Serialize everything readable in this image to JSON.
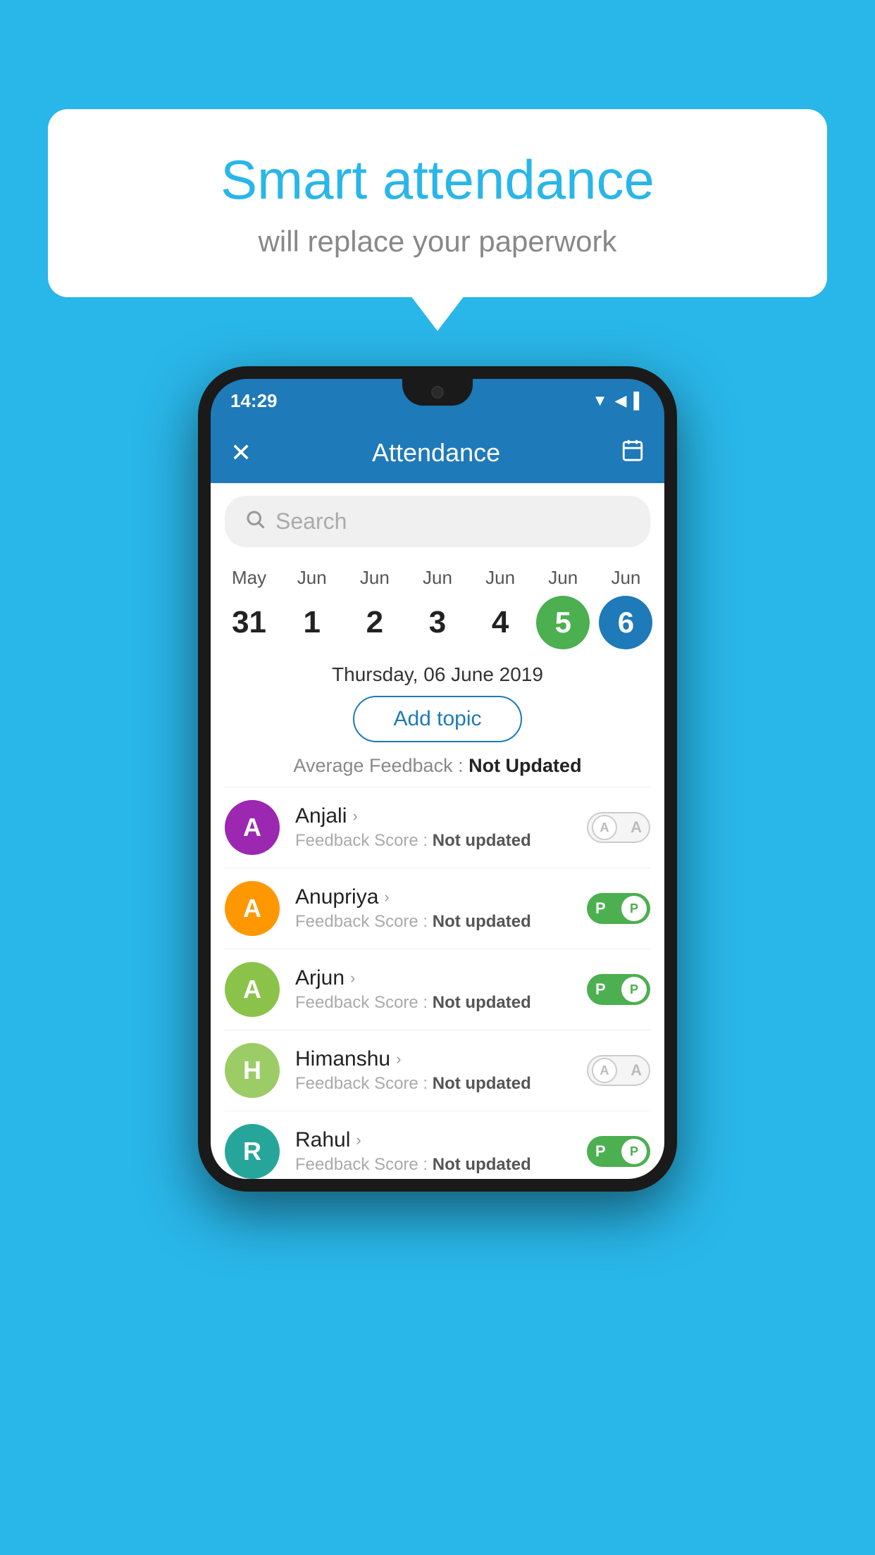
{
  "background_color": "#29b6e8",
  "speech_bubble": {
    "title": "Smart attendance",
    "subtitle": "will replace your paperwork"
  },
  "status_bar": {
    "time": "14:29",
    "icons": [
      "▼",
      "◀",
      "▌"
    ]
  },
  "app_header": {
    "title": "Attendance",
    "close_label": "✕",
    "calendar_icon": "📅"
  },
  "search": {
    "placeholder": "Search"
  },
  "calendar": {
    "days": [
      {
        "month": "May",
        "date": "31",
        "state": "normal"
      },
      {
        "month": "Jun",
        "date": "1",
        "state": "normal"
      },
      {
        "month": "Jun",
        "date": "2",
        "state": "normal"
      },
      {
        "month": "Jun",
        "date": "3",
        "state": "normal"
      },
      {
        "month": "Jun",
        "date": "4",
        "state": "normal"
      },
      {
        "month": "Jun",
        "date": "5",
        "state": "green"
      },
      {
        "month": "Jun",
        "date": "6",
        "state": "blue"
      }
    ]
  },
  "selected_date_label": "Thursday, 06 June 2019",
  "add_topic_label": "Add topic",
  "avg_feedback_prefix": "Average Feedback : ",
  "avg_feedback_value": "Not Updated",
  "students": [
    {
      "name": "Anjali",
      "avatar_letter": "A",
      "avatar_color": "purple",
      "feedback_label": "Feedback Score : ",
      "feedback_value": "Not updated",
      "attendance": "absent"
    },
    {
      "name": "Anupriya",
      "avatar_letter": "A",
      "avatar_color": "orange",
      "feedback_label": "Feedback Score : ",
      "feedback_value": "Not updated",
      "attendance": "present"
    },
    {
      "name": "Arjun",
      "avatar_letter": "A",
      "avatar_color": "light-green",
      "feedback_label": "Feedback Score : ",
      "feedback_value": "Not updated",
      "attendance": "present"
    },
    {
      "name": "Himanshu",
      "avatar_letter": "H",
      "avatar_color": "olive",
      "feedback_label": "Feedback Score : ",
      "feedback_value": "Not updated",
      "attendance": "absent"
    },
    {
      "name": "Rahul",
      "avatar_letter": "R",
      "avatar_color": "teal",
      "feedback_label": "Feedback Score : ",
      "feedback_value": "Not updated",
      "attendance": "present"
    }
  ]
}
